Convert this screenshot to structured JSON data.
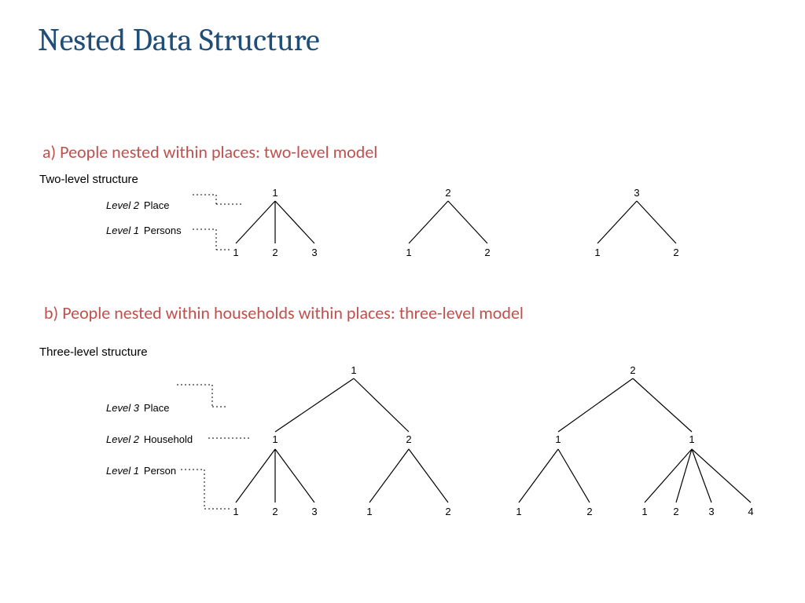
{
  "title": "Nested Data Structure",
  "section_a": {
    "heading": "a) People nested within places: two-level model",
    "figure_title": "Two-level structure",
    "levels": [
      {
        "label": "Level 2",
        "name": "Place"
      },
      {
        "label": "Level 1",
        "name": "Persons"
      }
    ],
    "trees": [
      {
        "top": "1",
        "children": [
          "1",
          "2",
          "3"
        ]
      },
      {
        "top": "2",
        "children": [
          "1",
          "2"
        ]
      },
      {
        "top": "3",
        "children": [
          "1",
          "2"
        ]
      }
    ]
  },
  "section_b": {
    "heading": "b) People nested within households within places: three-level model",
    "figure_title": "Three-level structure",
    "levels": [
      {
        "label": "Level 3",
        "name": "Place"
      },
      {
        "label": "Level 2",
        "name": "Household"
      },
      {
        "label": "Level 1",
        "name": "Person"
      }
    ],
    "trees": [
      {
        "top": "1",
        "households": [
          {
            "label": "1",
            "persons": [
              "1",
              "2",
              "3"
            ]
          },
          {
            "label": "2",
            "persons": [
              "1",
              "2"
            ]
          }
        ]
      },
      {
        "top": "2",
        "households": [
          {
            "label": "1",
            "persons": [
              "1",
              "2"
            ]
          },
          {
            "label": "1",
            "persons": [
              "1",
              "2",
              "3",
              "4"
            ]
          }
        ]
      }
    ]
  },
  "chart_data": {
    "type": "table",
    "description": "Hierarchical nested data structures",
    "two_level": {
      "levels": [
        "Place",
        "Persons"
      ],
      "places": [
        {
          "id": 1,
          "persons": [
            1,
            2,
            3
          ]
        },
        {
          "id": 2,
          "persons": [
            1,
            2
          ]
        },
        {
          "id": 3,
          "persons": [
            1,
            2
          ]
        }
      ]
    },
    "three_level": {
      "levels": [
        "Place",
        "Household",
        "Person"
      ],
      "places": [
        {
          "id": 1,
          "households": [
            {
              "id": 1,
              "persons": [
                1,
                2,
                3
              ]
            },
            {
              "id": 2,
              "persons": [
                1,
                2
              ]
            }
          ]
        },
        {
          "id": 2,
          "households": [
            {
              "id": 1,
              "persons": [
                1,
                2
              ]
            },
            {
              "id": 1,
              "persons": [
                1,
                2,
                3,
                4
              ]
            }
          ]
        }
      ]
    }
  }
}
